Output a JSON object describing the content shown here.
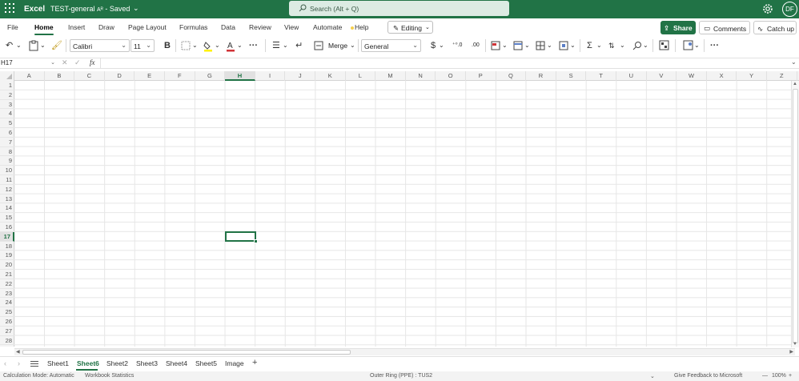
{
  "titlebar": {
    "app_name": "Excel",
    "doc_title": "TEST-general",
    "save_state": "Saved",
    "search_placeholder": "Search (Alt + Q)",
    "avatar_initials": "DF",
    "brand_color": "#217346"
  },
  "menu": {
    "tabs": [
      "File",
      "Home",
      "Insert",
      "Draw",
      "Page Layout",
      "Formulas",
      "Data",
      "Review",
      "View",
      "Automate",
      "Help"
    ],
    "active_tab": "Home",
    "editing_label": "Editing",
    "share_label": "Share",
    "comments_label": "Comments",
    "catchup_label": "Catch up"
  },
  "ribbon": {
    "font_name": "Calibri",
    "font_size": "11",
    "merge_label": "Merge",
    "number_format": "General",
    "icons": [
      "undo-icon",
      "paste-icon",
      "format-painter-icon",
      "bold-icon",
      "borders-icon",
      "fill-color-icon",
      "font-color-icon",
      "more-icon",
      "align-icon",
      "wrap-text-icon",
      "merge-icon",
      "currency-icon",
      "increase-decimal-icon",
      "decrease-decimal-icon",
      "conditional-format-icon",
      "format-as-table-icon",
      "cell-styles-icon",
      "insert-delete-icon",
      "autosum-icon",
      "sort-filter-icon",
      "find-icon",
      "add-ins-icon",
      "designer-icon",
      "more-icon"
    ]
  },
  "formula_bar": {
    "name_box": "H17",
    "fx": "fx",
    "content": ""
  },
  "grid": {
    "columns": [
      "A",
      "B",
      "C",
      "D",
      "E",
      "F",
      "G",
      "H",
      "I",
      "J",
      "K",
      "L",
      "M",
      "N",
      "O",
      "P",
      "Q",
      "R",
      "S",
      "T",
      "U",
      "V",
      "W",
      "X",
      "Y",
      "Z"
    ],
    "rows": [
      "1",
      "2",
      "3",
      "4",
      "5",
      "6",
      "7",
      "8",
      "9",
      "10",
      "11",
      "12",
      "13",
      "14",
      "15",
      "16",
      "17",
      "18",
      "19",
      "20",
      "21",
      "22",
      "23",
      "24",
      "25",
      "26",
      "27",
      "28"
    ],
    "selected_column": "H",
    "selected_row": "17"
  },
  "sheets": {
    "tabs": [
      "Sheet1",
      "Sheet6",
      "Sheet2",
      "Sheet3",
      "Sheet4",
      "Sheet5",
      "Image"
    ],
    "active": "Sheet6"
  },
  "status": {
    "calc_mode": "Calculation Mode: Automatic",
    "workbook_stats": "Workbook Statistics",
    "ring": "Outer Ring (PPE) : TUS2",
    "feedback": "Give Feedback to Microsoft",
    "zoom": "100%"
  }
}
